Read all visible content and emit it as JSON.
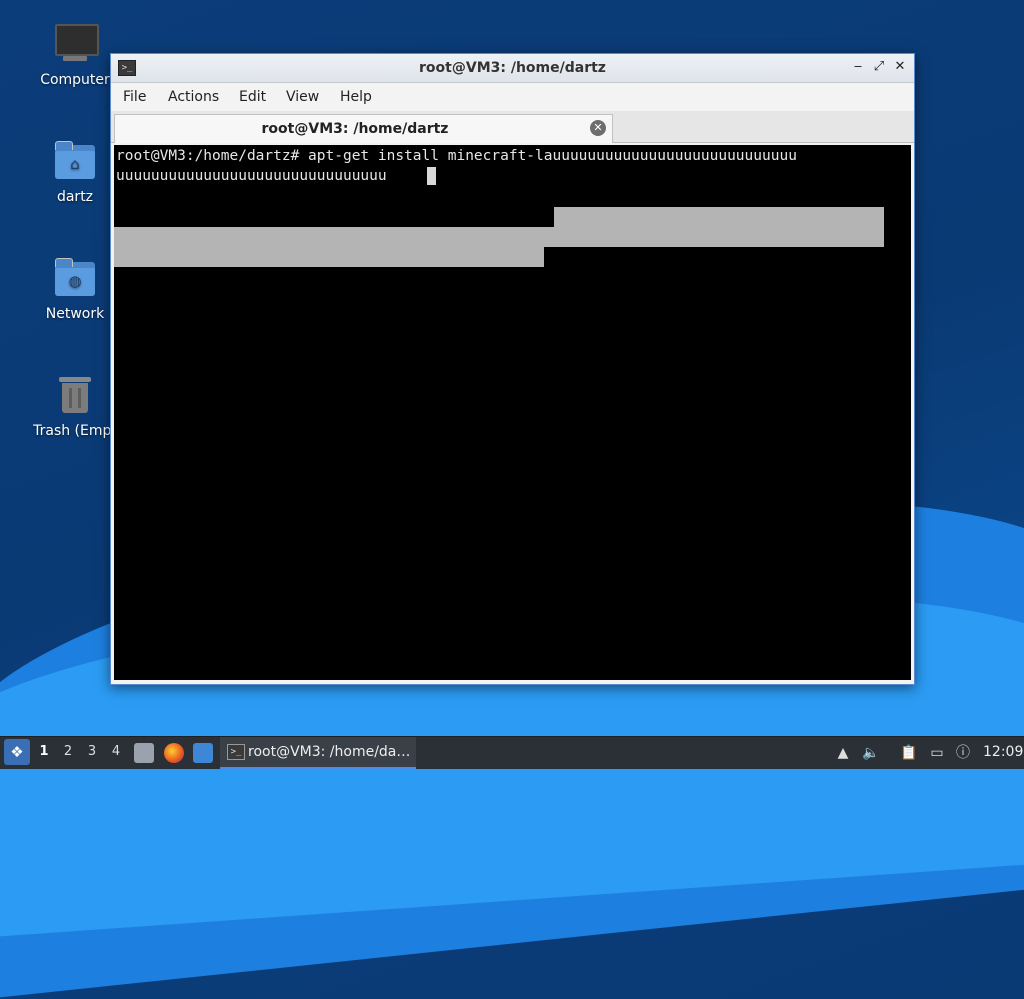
{
  "desktop": {
    "icons": [
      {
        "label": "Computer",
        "icon": "computer-icon"
      },
      {
        "label": "dartz",
        "icon": "home-folder-icon"
      },
      {
        "label": "Network",
        "icon": "network-folder-icon"
      },
      {
        "label": "Trash (Empt",
        "icon": "trash-icon"
      }
    ]
  },
  "window": {
    "title": "root@VM3: /home/dartz",
    "menu": [
      "File",
      "Actions",
      "Edit",
      "View",
      "Help"
    ],
    "tab_label": "root@VM3: /home/dartz",
    "terminal": {
      "line1": "root@VM3:/home/dartz# apt-get install minecraft-lauuuuuuuuuuuuuuuuuuuuuuuuuuuu",
      "line2": "uuuuuuuuuuuuuuuuuuuuuuuuuuuuuuu"
    }
  },
  "taskbar": {
    "workspaces": [
      "1",
      "2",
      "3",
      "4"
    ],
    "active_workspace": "1",
    "task_label": "root@VM3: /home/da…",
    "clock": "12:09",
    "accent_color": "#4c8be8"
  }
}
